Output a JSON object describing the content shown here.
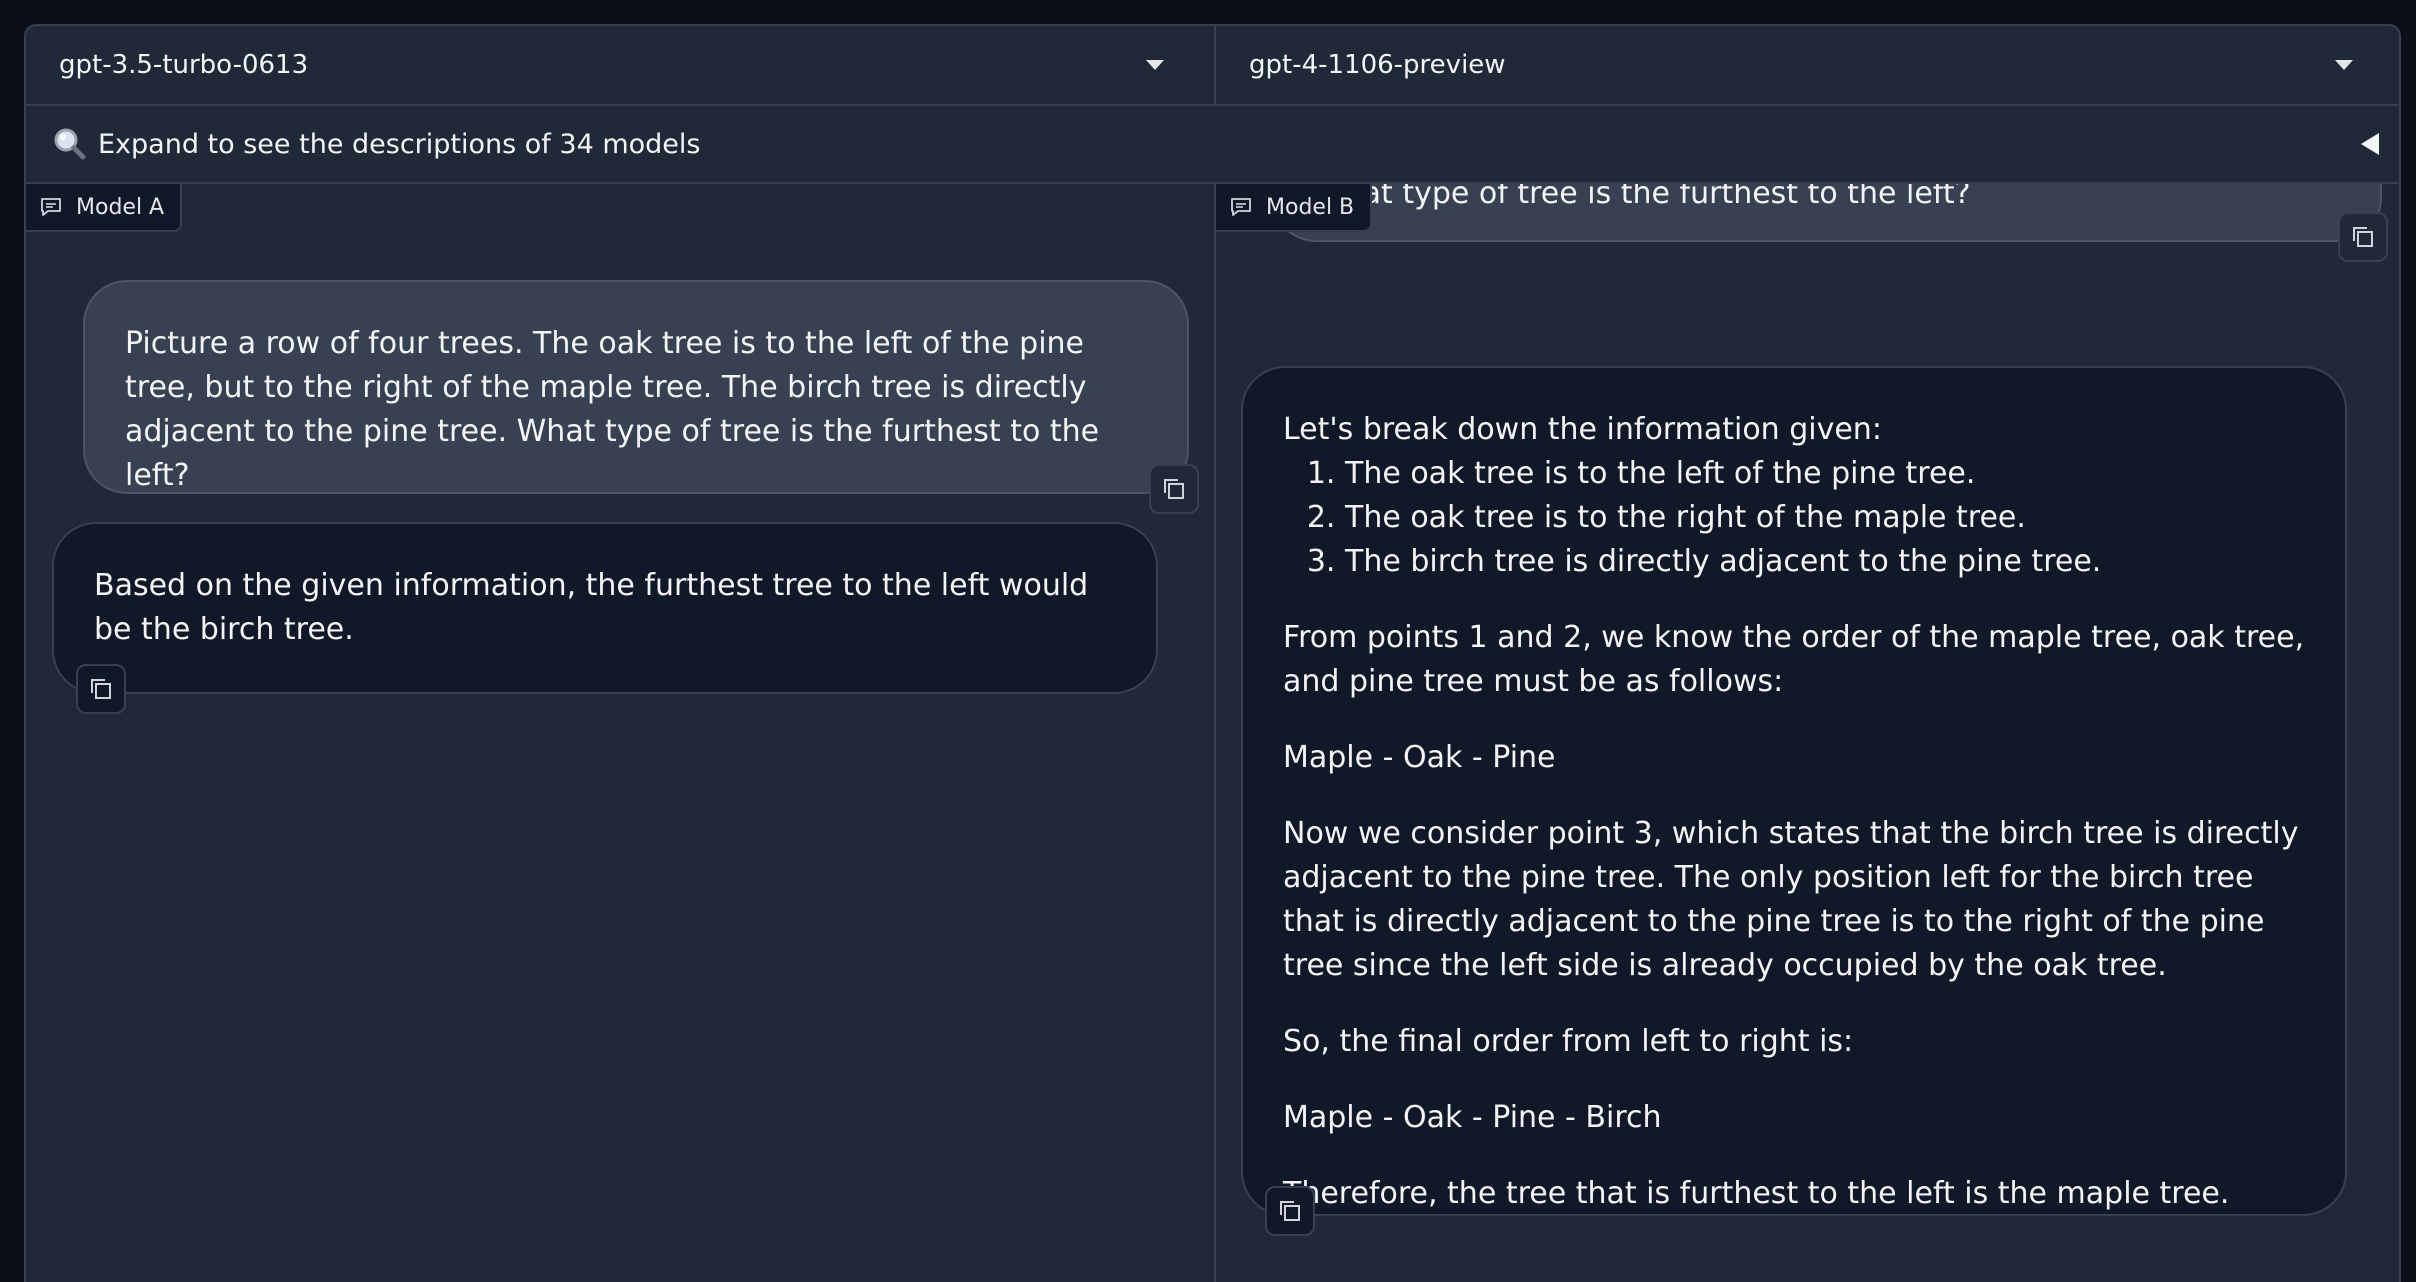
{
  "model_a": {
    "name": "gpt-3.5-turbo-0613",
    "tag": "Model A"
  },
  "model_b": {
    "name": "gpt-4-1106-preview",
    "tag": "Model B"
  },
  "descriptions": {
    "label": "Expand to see the descriptions of 34 models"
  },
  "chat_a": {
    "user": "Picture a row of four trees. The oak tree is to the left of the pine tree, but to the right of the maple tree. The birch tree is directly adjacent to the pine tree. What type of tree is the furthest to the left?",
    "bot": "Based on the given information, the furthest tree to the left would be the birch tree."
  },
  "chat_b": {
    "user_tail": "What type of tree is the furthest to the left?",
    "intro": "Let's break down the information given:",
    "points": [
      "The oak tree is to the left of the pine tree.",
      "The oak tree is to the right of the maple tree.",
      "The birch tree is directly adjacent to the pine tree."
    ],
    "p1": "From points 1 and 2, we know the order of the maple tree, oak tree, and pine tree must be as follows:",
    "order1": "Maple - Oak - Pine",
    "p2": "Now we consider point 3, which states that the birch tree is directly adjacent to the pine tree. The only position left for the birch tree that is directly adjacent to the pine tree is to the right of the pine tree since the left side is already occupied by the oak tree.",
    "p3": "So, the final order from left to right is:",
    "order2": "Maple - Oak - Pine - Birch",
    "p4": "Therefore, the tree that is furthest to the left is the maple tree."
  }
}
